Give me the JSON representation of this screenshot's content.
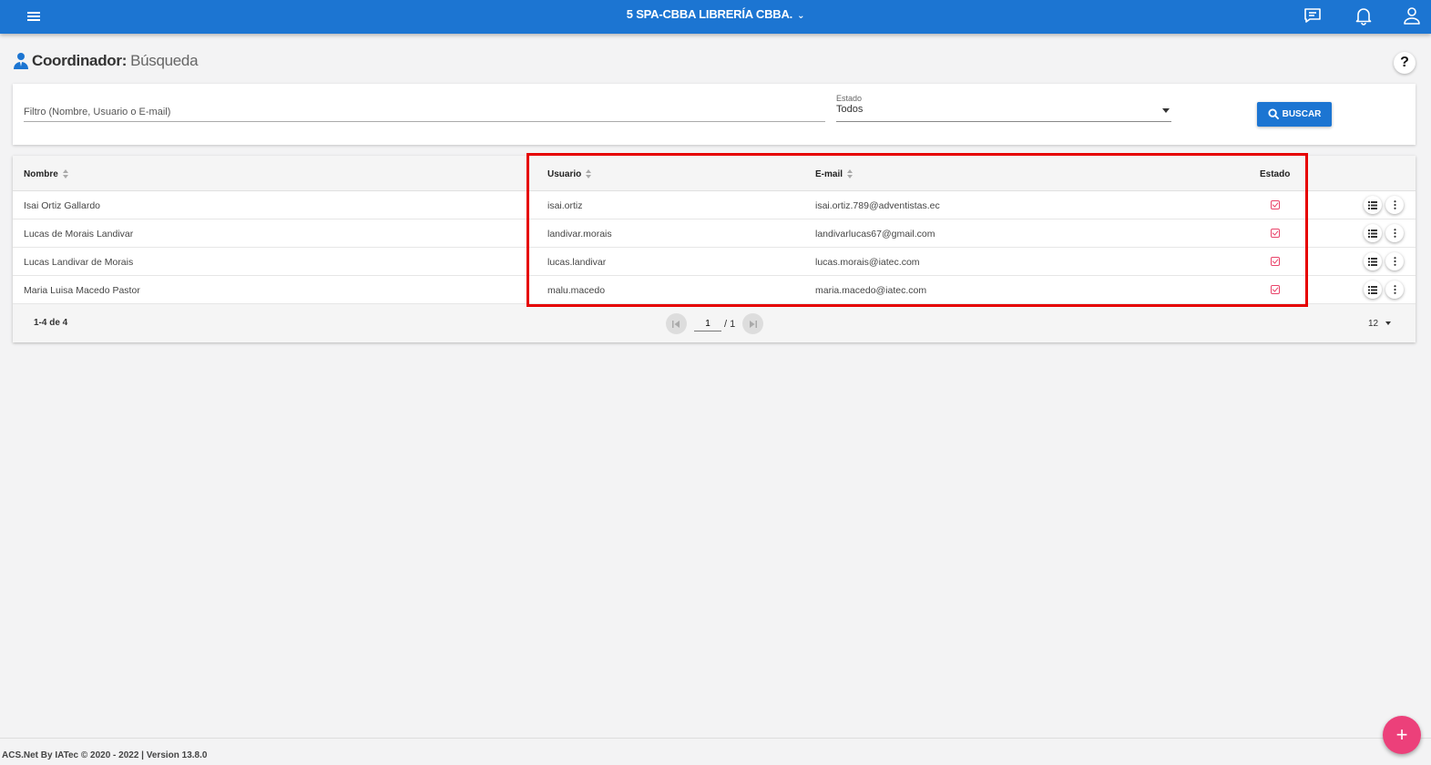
{
  "header": {
    "title": "5 SPA-CBBA LIBRERÍA CBBA.",
    "icons": [
      "menu-icon",
      "chat-icon",
      "bell-icon",
      "user-icon"
    ]
  },
  "page": {
    "title_main": "Coordinador:",
    "title_sub": "Búsqueda",
    "help_label": "?"
  },
  "filter": {
    "placeholder": "Filtro (Nombre, Usuario o E-mail)",
    "estado_label": "Estado",
    "estado_value": "Todos",
    "search_label": "BUSCAR"
  },
  "table": {
    "columns": {
      "nombre": "Nombre",
      "usuario": "Usuario",
      "email": "E-mail",
      "estado": "Estado"
    },
    "rows": [
      {
        "nombre": "Isai Ortiz Gallardo",
        "usuario": "isai.ortiz",
        "email": "isai.ortiz.789@adventistas.ec",
        "activo": true
      },
      {
        "nombre": "Lucas de Morais Landivar",
        "usuario": "landivar.morais",
        "email": "landivarlucas67@gmail.com",
        "activo": true
      },
      {
        "nombre": "Lucas Landivar de Morais",
        "usuario": "lucas.landivar",
        "email": "lucas.morais@iatec.com",
        "activo": true
      },
      {
        "nombre": "Maria Luisa Macedo Pastor",
        "usuario": "malu.macedo",
        "email": "maria.macedo@iatec.com",
        "activo": true
      }
    ]
  },
  "pagination": {
    "range": "1-4 de 4",
    "page": "1",
    "total": "/ 1",
    "per_page": "12"
  },
  "footer": {
    "text": "ACS.Net By IATec © 2020 - 2022 | Version 13.8.0"
  },
  "colors": {
    "primary": "#1c75d2",
    "accent": "#ec407a",
    "highlight": "#e60000"
  }
}
